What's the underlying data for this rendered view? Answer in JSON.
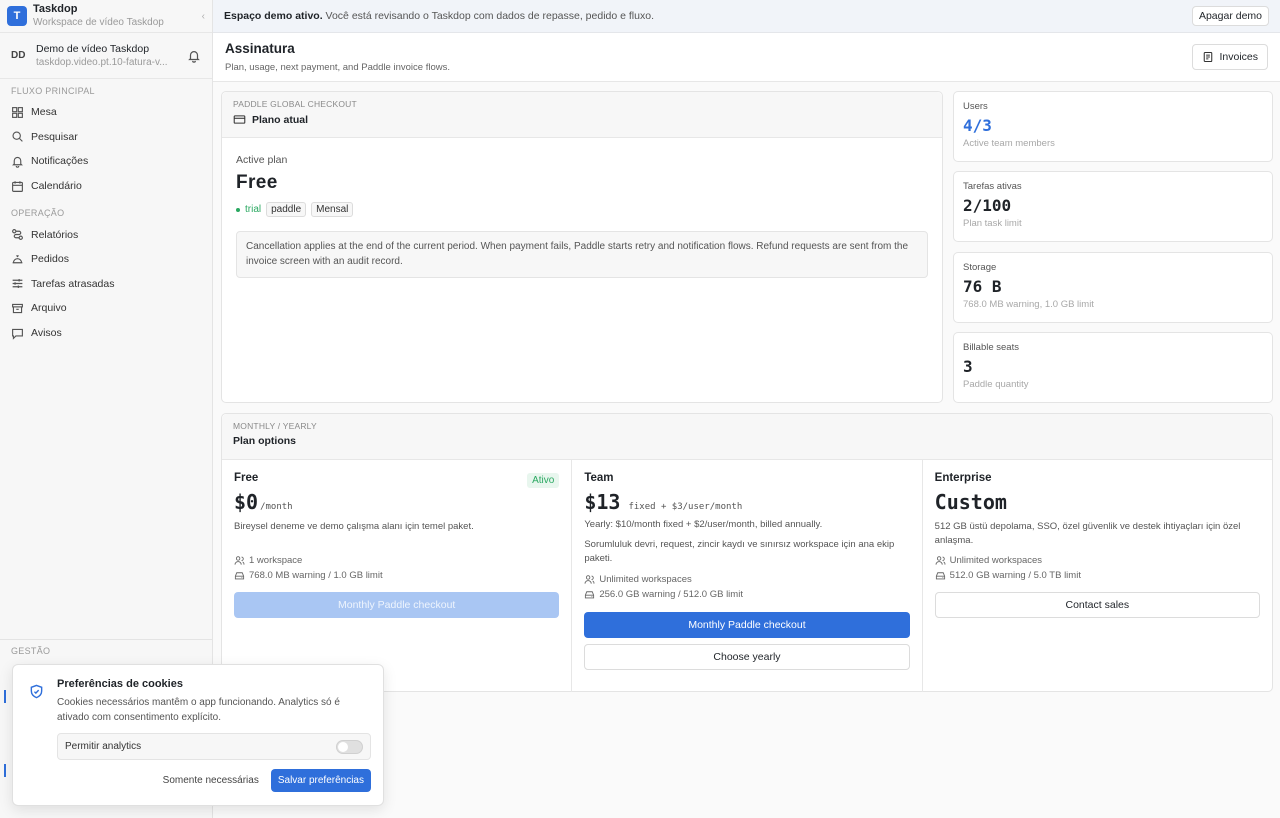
{
  "brand": {
    "logo": "T",
    "name": "Taskdop",
    "subtitle": "Workspace de vídeo Taskdop",
    "collapse_icon": "chevron-left-icon"
  },
  "account": {
    "initials": "DD",
    "name": "Demo de vídeo Taskdop",
    "subtitle": "taskdop.video.pt.10-fatura-v..."
  },
  "sidebar": {
    "sections": [
      {
        "label": "FLUXO PRINCIPAL",
        "items": [
          {
            "label": "Mesa",
            "icon": "grid-icon"
          },
          {
            "label": "Pesquisar",
            "icon": "search-icon"
          },
          {
            "label": "Notificações",
            "icon": "bell-icon"
          },
          {
            "label": "Calendário",
            "icon": "calendar-icon"
          }
        ]
      },
      {
        "label": "OPERAÇÃO",
        "items": [
          {
            "label": "Relatórios",
            "icon": "route-icon"
          },
          {
            "label": "Pedidos",
            "icon": "bell-service-icon"
          },
          {
            "label": "Tarefas atrasadas",
            "icon": "sliders-icon"
          },
          {
            "label": "Arquivo",
            "icon": "archive-icon"
          },
          {
            "label": "Avisos",
            "icon": "message-icon"
          }
        ]
      }
    ],
    "gestao_label": "GESTÃO"
  },
  "banner": {
    "bold": "Espaço demo ativo.",
    "text": " Você está revisando o Taskdop com dados de repasse, pedido e fluxo.",
    "button": "Apagar demo"
  },
  "header": {
    "title": "Assinatura",
    "subtitle": "Plan, usage, next payment, and Paddle invoice flows.",
    "invoices_button": "Invoices"
  },
  "current_plan": {
    "eyebrow": "PADDLE GLOBAL CHECKOUT",
    "title": "Plano atual",
    "label": "Active plan",
    "name": "Free",
    "status": "trial",
    "tags": [
      "paddle",
      "Mensal"
    ],
    "notice": "Cancellation applies at the end of the current period. When payment fails, Paddle starts retry and notification flows. Refund requests are sent from the invoice screen with an audit record."
  },
  "stats": [
    {
      "label": "Users",
      "value": "4/3",
      "sub": "Active team members",
      "highlight": true
    },
    {
      "label": "Tarefas ativas",
      "value": "2/100",
      "sub": "Plan task limit"
    },
    {
      "label": "Storage",
      "value": "76 B",
      "sub": "768.0 MB warning, 1.0 GB limit"
    },
    {
      "label": "Billable seats",
      "value": "3",
      "sub": "Paddle quantity"
    }
  ],
  "plan_options": {
    "eyebrow": "MONTHLY / YEARLY",
    "title": "Plan options",
    "plans": [
      {
        "name": "Free",
        "badge": "Ativo",
        "price": "$0",
        "price_suffix": "/month",
        "yearly": "",
        "description": "Bireysel deneme ve demo çalışma alanı için temel paket.",
        "features": [
          "1 workspace",
          "768.0 MB warning / 1.0 GB limit"
        ],
        "primary": "Monthly Paddle checkout",
        "primary_disabled": true,
        "secondary": ""
      },
      {
        "name": "Team",
        "badge": "",
        "price": "$13",
        "price_suffix": "fixed + $3/user/month",
        "yearly": "Yearly: $10/month fixed + $2/user/month, billed annually.",
        "description": "Sorumluluk devri, request, zincir kaydı ve sınırsız workspace için ana ekip paketi.",
        "features": [
          "Unlimited workspaces",
          "256.0 GB warning / 512.0 GB limit"
        ],
        "primary": "Monthly Paddle checkout",
        "primary_disabled": false,
        "secondary": "Choose yearly"
      },
      {
        "name": "Enterprise",
        "badge": "",
        "price": "Custom",
        "price_suffix": "",
        "yearly": "",
        "description": "512 GB üstü depolama, SSO, özel güvenlik ve destek ihtiyaçları için özel anlaşma.",
        "features": [
          "Unlimited workspaces",
          "512.0 GB warning / 5.0 TB limit"
        ],
        "primary": "",
        "primary_disabled": false,
        "secondary": "Contact sales"
      }
    ]
  },
  "cookie": {
    "title": "Preferências de cookies",
    "text": "Cookies necessários mantêm o app funcionando. Analytics só é ativado com consentimento explícito.",
    "toggle_label": "Permitir analytics",
    "toggle_on": false,
    "only_necessary": "Somente necessárias",
    "save": "Salvar preferências"
  },
  "colors": {
    "accent": "#2f6fdb",
    "success": "#2aa861"
  }
}
